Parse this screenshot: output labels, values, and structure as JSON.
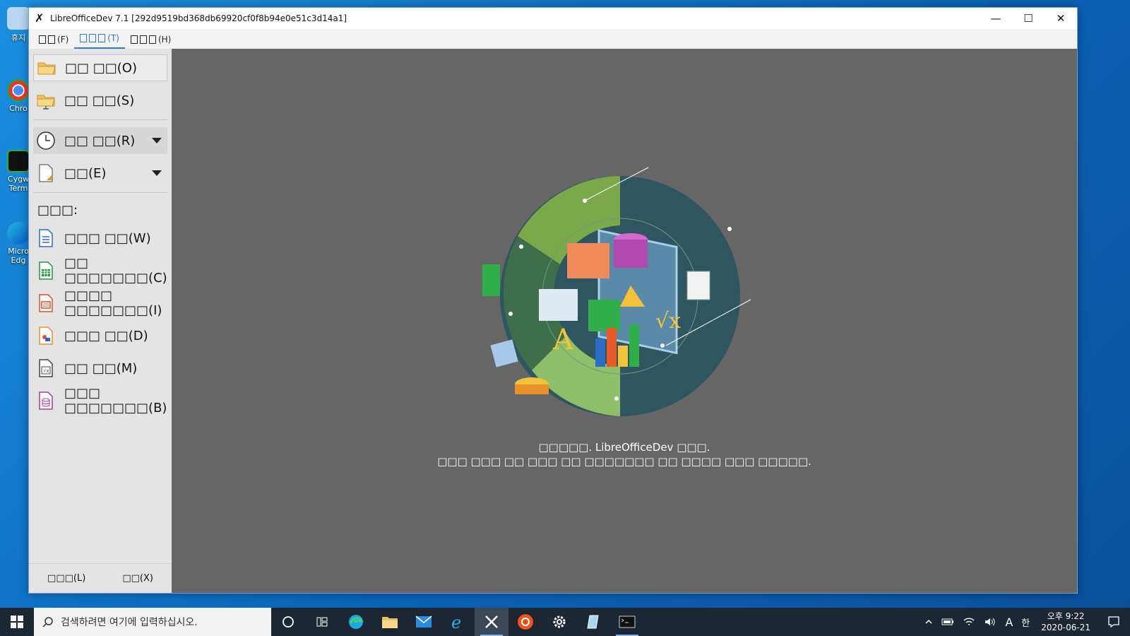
{
  "desktop": {
    "icons": [
      {
        "label": "휴지"
      },
      {
        "label": "Chro"
      },
      {
        "label": "Cygw Term"
      },
      {
        "label": "Micro Edg"
      }
    ]
  },
  "window": {
    "title": "LibreOfficeDev 7.1 [292d9519bd368db69920cf0f8b94e0e51c3d14a1]",
    "controls": {
      "minimize": "—",
      "maximize": "☐",
      "close": "✕"
    }
  },
  "menubar": {
    "items": [
      {
        "label": "(F)"
      },
      {
        "label": "(T)"
      },
      {
        "label": "(H)"
      }
    ]
  },
  "sidebar": {
    "open_file": "□□ □□(O)",
    "remote_files": "□□ □□(S)",
    "recent_docs": "□□ □□(R)",
    "templates": "□□(E)",
    "create_label": "□□□:",
    "create": [
      {
        "label": "□□□ □□(W)",
        "color": "#2b6cc4"
      },
      {
        "label": "□□ □□□□□□□(C)",
        "color": "#1e9a3b"
      },
      {
        "label": "□□□□ □□□□□□□(I)",
        "color": "#d9542a"
      },
      {
        "label": "□□□ □□(D)",
        "color": "#e8912a"
      },
      {
        "label": "□□ □□(M)",
        "color": "#444444"
      },
      {
        "label": "□□□ □□□□□□□(B)",
        "color": "#a33b9e"
      }
    ],
    "footer": {
      "help": "□□□(L)",
      "extensions": "□□(X)"
    }
  },
  "main": {
    "welcome_line1": "□□□□□. LibreOfficeDev □□□.",
    "welcome_line2": "□□□ □□□ □□ □□□ □□ □□□□□□□ □□ □□□□ □□□ □□□□□."
  },
  "taskbar": {
    "search_placeholder": "검색하려면 여기에 입력하십시오.",
    "ime_indicator": "A",
    "ime_lang": "한",
    "clock_time": "오후 9:22",
    "clock_date": "2020-06-21"
  }
}
